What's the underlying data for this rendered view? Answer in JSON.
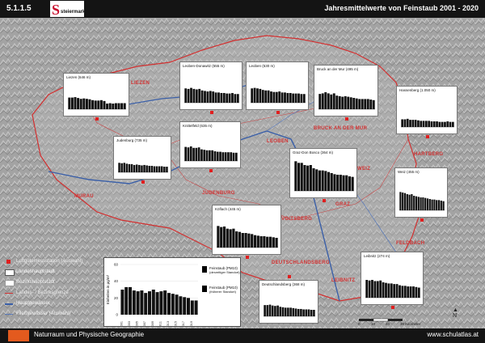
{
  "header": {
    "number": "5.1.1.5",
    "logo_text": "steiermark",
    "title": "Jahresmittelwerte von Feinstaub 2001 - 2020"
  },
  "footer": {
    "left": "Naturraum und Physische Geographie",
    "right": "www.schulatlas.at"
  },
  "legend": {
    "items": [
      {
        "label": "Luftgütemessstation (Auswahl)",
        "symbol": "red-square-icon"
      },
      {
        "label": "Landeshauptstadt",
        "symbol": "white-box-icon"
      },
      {
        "label": "Bezirkshauptstadt",
        "symbol": "white-box-icon"
      },
      {
        "label": "Landes- / Bezirksgrenze",
        "symbol": "red-line-icon"
      },
      {
        "label": "Hauptgewässer",
        "symbol": "blue-line-icon"
      },
      {
        "label": "Fließgewässer (Auswahl)",
        "symbol": "thin-blue-line-icon"
      }
    ]
  },
  "big_chart": {
    "ylabel": "Einheiten in µg/m³",
    "yticks": [
      "60",
      "40",
      "20",
      "0"
    ],
    "xticks": [
      "2001",
      "2003",
      "2005",
      "2007",
      "2009",
      "2011",
      "2013",
      "2015",
      "2017",
      "2019"
    ],
    "legend": [
      {
        "label": "Feinstaub (PM10)",
        "sub": "(derzeitiger Standort)",
        "color": "#000000"
      },
      {
        "label": "Feinstaub (PM10)",
        "sub": "(früherer Standort)",
        "color": "#000000"
      }
    ]
  },
  "places": [
    {
      "label": "LIEZEN"
    },
    {
      "label": "LEOBEN"
    },
    {
      "label": "BRUCK AN DER MUR"
    },
    {
      "label": "HARTBERG"
    },
    {
      "label": "MURAU"
    },
    {
      "label": "JUDENBURG"
    },
    {
      "label": "VOITSBERG"
    },
    {
      "label": "GRAZ"
    },
    {
      "label": "WEIZ"
    },
    {
      "label": "FELDBACH"
    },
    {
      "label": "DEUTSCHLANDSBERG"
    },
    {
      "label": "LEIBNITZ"
    }
  ],
  "scale": {
    "ticks": [
      "0",
      "10",
      "20",
      "30 Kilometer"
    ]
  },
  "north": "N",
  "chart_data": [
    {
      "type": "bar",
      "title": "Liezen (646 m)",
      "categories": [
        "2001",
        "2002",
        "2003",
        "2004",
        "2005",
        "2006",
        "2007",
        "2008",
        "2009",
        "2010",
        "2011",
        "2012",
        "2013",
        "2014",
        "2015",
        "2016",
        "2017",
        "2018",
        "2019",
        "2020"
      ],
      "values": [
        27,
        27,
        28,
        26,
        24,
        25,
        24,
        23,
        21,
        20,
        20,
        21,
        19,
        13,
        14,
        13,
        14,
        14,
        14,
        14
      ],
      "ylim": [
        0,
        60
      ]
    },
    {
      "type": "bar",
      "title": "Leoben-Donawitz (555 m)",
      "categories": [
        "2001",
        "2002",
        "2003",
        "2004",
        "2005",
        "2006",
        "2007",
        "2008",
        "2009",
        "2010",
        "2011",
        "2012",
        "2013",
        "2014",
        "2015",
        "2016",
        "2017",
        "2018",
        "2019",
        "2020"
      ],
      "values": [
        28,
        27,
        29,
        27,
        26,
        27,
        24,
        23,
        22,
        23,
        22,
        20,
        20,
        19,
        19,
        18,
        18,
        19,
        17,
        17
      ],
      "ylim": [
        0,
        60
      ]
    },
    {
      "type": "bar",
      "title": "Leoben (530 m)",
      "categories": [
        "2001",
        "2002",
        "2003",
        "2004",
        "2005",
        "2006",
        "2007",
        "2008",
        "2009",
        "2010",
        "2011",
        "2012",
        "2013",
        "2014",
        "2015",
        "2016",
        "2017",
        "2018",
        "2019",
        "2020"
      ],
      "values": [
        28,
        29,
        28,
        27,
        25,
        24,
        24,
        22,
        21,
        21,
        22,
        20,
        20,
        19,
        19,
        18,
        18,
        18,
        17,
        17
      ],
      "ylim": [
        0,
        60
      ]
    },
    {
      "type": "bar",
      "title": "Bruck an der Mur (495 m)",
      "categories": [
        "2001",
        "2002",
        "2003",
        "2004",
        "2005",
        "2006",
        "2007",
        "2008",
        "2009",
        "2010",
        "2011",
        "2012",
        "2013",
        "2014",
        "2015",
        "2016",
        "2017",
        "2018",
        "2019",
        "2020"
      ],
      "values": [
        27,
        28,
        30,
        28,
        26,
        28,
        24,
        23,
        22,
        23,
        22,
        21,
        20,
        19,
        18,
        18,
        18,
        18,
        17,
        16
      ],
      "ylim": [
        0,
        60
      ]
    },
    {
      "type": "bar",
      "title": "Hassenberg (1.050 m)",
      "categories": [
        "2001",
        "2002",
        "2003",
        "2004",
        "2005",
        "2006",
        "2007",
        "2008",
        "2009",
        "2010",
        "2011",
        "2012",
        "2013",
        "2014",
        "2015",
        "2016",
        "2017",
        "2018",
        "2019",
        "2020"
      ],
      "values": [
        15,
        15,
        16,
        14,
        14,
        14,
        13,
        12,
        12,
        12,
        12,
        11,
        11,
        11,
        10,
        10,
        10,
        11,
        10,
        10
      ],
      "ylim": [
        0,
        60
      ]
    },
    {
      "type": "bar",
      "title": "Judenburg (735 m)",
      "categories": [
        "2001",
        "2002",
        "2003",
        "2004",
        "2005",
        "2006",
        "2007",
        "2008",
        "2009",
        "2010",
        "2011",
        "2012",
        "2013",
        "2014",
        "2015",
        "2016",
        "2017",
        "2018",
        "2019",
        "2020"
      ],
      "values": [
        22,
        21,
        22,
        20,
        19,
        19,
        17,
        18,
        17,
        16,
        17,
        16,
        15,
        15,
        14,
        14,
        14,
        14,
        13,
        13
      ],
      "ylim": [
        0,
        60
      ]
    },
    {
      "type": "bar",
      "title": "Knittelfeld (635 m)",
      "categories": [
        "2001",
        "2002",
        "2003",
        "2004",
        "2005",
        "2006",
        "2007",
        "2008",
        "2009",
        "2010",
        "2011",
        "2012",
        "2013",
        "2014",
        "2015",
        "2016",
        "2017",
        "2018",
        "2019",
        "2020"
      ],
      "values": [
        29,
        28,
        30,
        27,
        27,
        28,
        24,
        23,
        22,
        22,
        22,
        20,
        19,
        19,
        18,
        18,
        18,
        18,
        17,
        17
      ],
      "ylim": [
        0,
        60
      ]
    },
    {
      "type": "bar",
      "title": "Graz-Don Bosco (364 m)",
      "categories": [
        "2001",
        "2002",
        "2003",
        "2004",
        "2005",
        "2006",
        "2007",
        "2008",
        "2009",
        "2010",
        "2011",
        "2012",
        "2013",
        "2014",
        "2015",
        "2016",
        "2017",
        "2018",
        "2019",
        "2020"
      ],
      "values": [
        55,
        52,
        52,
        48,
        47,
        48,
        42,
        40,
        38,
        38,
        37,
        35,
        33,
        31,
        30,
        30,
        29,
        29,
        27,
        26
      ],
      "ylim": [
        0,
        60
      ]
    },
    {
      "type": "bar",
      "title": "Weiz (455 m)",
      "categories": [
        "2001",
        "2002",
        "2003",
        "2004",
        "2005",
        "2006",
        "2007",
        "2008",
        "2009",
        "2010",
        "2011",
        "2012",
        "2013",
        "2014",
        "2015",
        "2016",
        "2017",
        "2018",
        "2019",
        "2020"
      ],
      "values": [
        34,
        33,
        32,
        30,
        29,
        30,
        27,
        26,
        25,
        24,
        24,
        23,
        22,
        21,
        20,
        20,
        19,
        19,
        18,
        17
      ],
      "ylim": [
        0,
        60
      ]
    },
    {
      "type": "bar",
      "title": "Köflach (445 m)",
      "categories": [
        "2001",
        "2002",
        "2003",
        "2004",
        "2005",
        "2006",
        "2007",
        "2008",
        "2009",
        "2010",
        "2011",
        "2012",
        "2013",
        "2014",
        "2015",
        "2016",
        "2017",
        "2018",
        "2019",
        "2020"
      ],
      "values": [
        40,
        38,
        39,
        35,
        34,
        35,
        30,
        29,
        27,
        27,
        26,
        25,
        23,
        22,
        21,
        21,
        20,
        20,
        19,
        18
      ],
      "ylim": [
        0,
        60
      ]
    },
    {
      "type": "bar",
      "title": "Leibnitz (274 m)",
      "categories": [
        "2001",
        "2002",
        "2003",
        "2004",
        "2005",
        "2006",
        "2007",
        "2008",
        "2009",
        "2010",
        "2011",
        "2012",
        "2013",
        "2014",
        "2015",
        "2016",
        "2017",
        "2018",
        "2019",
        "2020"
      ],
      "values": [
        30,
        29,
        30,
        28,
        28,
        29,
        26,
        25,
        24,
        24,
        23,
        23,
        21,
        20,
        20,
        19,
        19,
        19,
        18,
        17
      ],
      "ylim": [
        0,
        60
      ]
    },
    {
      "type": "bar",
      "title": "Deutschlandsberg (368 m)",
      "categories": [
        "2001",
        "2002",
        "2003",
        "2004",
        "2005",
        "2006",
        "2007",
        "2008",
        "2009",
        "2010",
        "2011",
        "2012",
        "2013",
        "2014",
        "2015",
        "2016",
        "2017",
        "2018",
        "2019",
        "2020"
      ],
      "values": [
        26,
        26,
        27,
        25,
        24,
        25,
        22,
        21,
        20,
        20,
        20,
        19,
        18,
        17,
        17,
        16,
        16,
        16,
        15,
        15
      ],
      "ylim": [
        0,
        60
      ]
    },
    {
      "type": "bar",
      "title": "",
      "categories": [
        "2001",
        "2002",
        "2003",
        "2004",
        "2005",
        "2006",
        "2007",
        "2008",
        "2009",
        "2010",
        "2011",
        "2012",
        "2013",
        "2014",
        "2015",
        "2016",
        "2017",
        "2018",
        "2019",
        "2020"
      ],
      "values": [
        30,
        33,
        33,
        29,
        28,
        29,
        26,
        28,
        30,
        27,
        28,
        29,
        26,
        25,
        24,
        22,
        21,
        20,
        17,
        17
      ],
      "ylim": [
        0,
        60
      ],
      "ylabel": "Einheiten in µg/m³"
    }
  ]
}
